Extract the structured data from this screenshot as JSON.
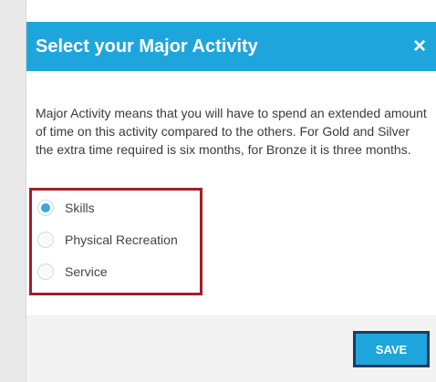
{
  "dialog": {
    "title": "Select your Major Activity",
    "close_icon": "×",
    "description": "Major Activity means that you will have to spend an extended amount of time on this activity compared to the others. For Gold and Silver the extra time required is six months, for Bronze it is three months.",
    "options": [
      {
        "label": "Skills",
        "selected": true
      },
      {
        "label": "Physical Recreation",
        "selected": false
      },
      {
        "label": "Service",
        "selected": false
      }
    ],
    "save_label": "SAVE"
  },
  "colors": {
    "header": "#1ea5dc",
    "highlight_border": "#a31d2a",
    "save_border": "#1e3a5f"
  },
  "icons": [
    "close-icon",
    "radio-selected-icon",
    "radio-unselected-icon"
  ]
}
